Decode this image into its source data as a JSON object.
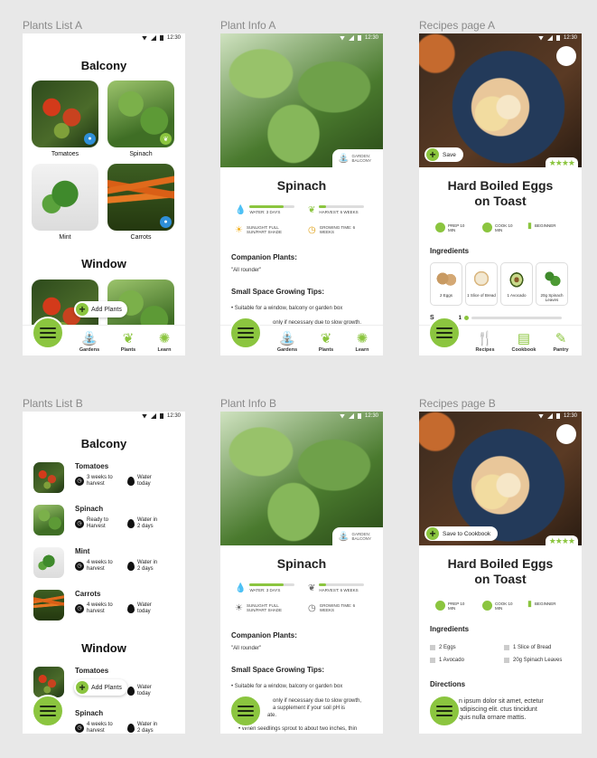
{
  "labels": {
    "plants_list_a": "Plants List A",
    "plant_info_a": "Plant Info A",
    "recipes_page_a": "Recipes page A",
    "plants_list_b": "Plants List B",
    "plant_info_b": "Plant Info B",
    "recipes_page_b": "Recipes page B"
  },
  "status": {
    "time": "12:30"
  },
  "nav": {
    "plants": [
      {
        "label": "Gardens",
        "icon": "watering-can-icon",
        "glyph": "⛲"
      },
      {
        "label": "Plants",
        "icon": "sprout-icon",
        "glyph": "❦"
      },
      {
        "label": "Learn",
        "icon": "lightbulb-icon",
        "glyph": "✺"
      }
    ],
    "recipes": [
      {
        "label": "Recipes",
        "icon": "utensils-icon",
        "glyph": "🍴"
      },
      {
        "label": "Cookbook",
        "icon": "book-icon",
        "glyph": "▤"
      },
      {
        "label": "Pantry",
        "icon": "carrot-icon",
        "glyph": "✎"
      }
    ]
  },
  "plants_list_a": {
    "balcony_title": "Balcony",
    "window_title": "Window",
    "add_label": "Add Plants",
    "tiles": [
      {
        "name": "Tomatoes",
        "badge": "water"
      },
      {
        "name": "Spinach",
        "badge": "harvest"
      },
      {
        "name": "Mint",
        "badge": "none"
      },
      {
        "name": "Carrots",
        "badge": "water"
      }
    ]
  },
  "plants_list_b": {
    "balcony_title": "Balcony",
    "window_title": "Window",
    "add_label": "Add Plants",
    "rows": [
      {
        "name": "Tomatoes",
        "harvest": "3 weeks to harvest",
        "water": "Water today"
      },
      {
        "name": "Spinach",
        "harvest": "Ready to Harvest",
        "water": "Water in 2 days"
      },
      {
        "name": "Mint",
        "harvest": "4 weeks to harvest",
        "water": "Water in 2 days"
      },
      {
        "name": "Carrots",
        "harvest": "4 weeks to harvest",
        "water": "Water today"
      }
    ],
    "window_rows": [
      {
        "name": "Tomatoes",
        "harvest": "",
        "water": "Water today"
      },
      {
        "name": "Spinach",
        "harvest": "4 weeks to harvest",
        "water": "Water in 2 days"
      }
    ]
  },
  "plant_info": {
    "garden_chip": "GARDEN: BALCONY",
    "title": "Spinach",
    "water": "WATER: 3 DAYS",
    "water_level": 0.75,
    "harvest": "HARVEST: 6 WEEKS",
    "harvest_level": 0.15,
    "sunlight": "SUNLIGHT: FULL SUN/PART SHADE",
    "growing_time": "GROWING TIME: 6 WEEKS",
    "companion_title": "Companion Plants:",
    "companion_text": "\"All rounder\"",
    "tips_title": "Small Space Growing Tips:",
    "tip1": "Suitable for a window, balcony or garden box",
    "tip2_a": "only if necessary due to slow growth.",
    "tip2_b": "only if necessary due to slow growth,",
    "tip3_b": "a supplement if your soil pH is",
    "tip4_b": "ate.",
    "tip5_b": "When seedlings sprout to about two inches, thin"
  },
  "recipes": {
    "save_a": "Save",
    "save_b": "Save to Cookbook",
    "stars": "★★★★",
    "title_line1": "Hard Boiled Eggs",
    "title_line2": "on Toast",
    "prep": "PREP 10 MIN",
    "cook": "COOK 10 MIN",
    "level": "BEGINNER",
    "ingredients_title": "Ingredients",
    "servings_label": "S",
    "servings_value": "1",
    "ingredients": [
      "2 Eggs",
      "1 Slice of Bread",
      "1 Avocado",
      "20g Spinach Leaves"
    ],
    "directions_title": "Directions",
    "directions_text": "n ipsum dolor sit amet, ectetur adipiscing elit. ctus tincidunt quis nulla ornare mattis."
  }
}
